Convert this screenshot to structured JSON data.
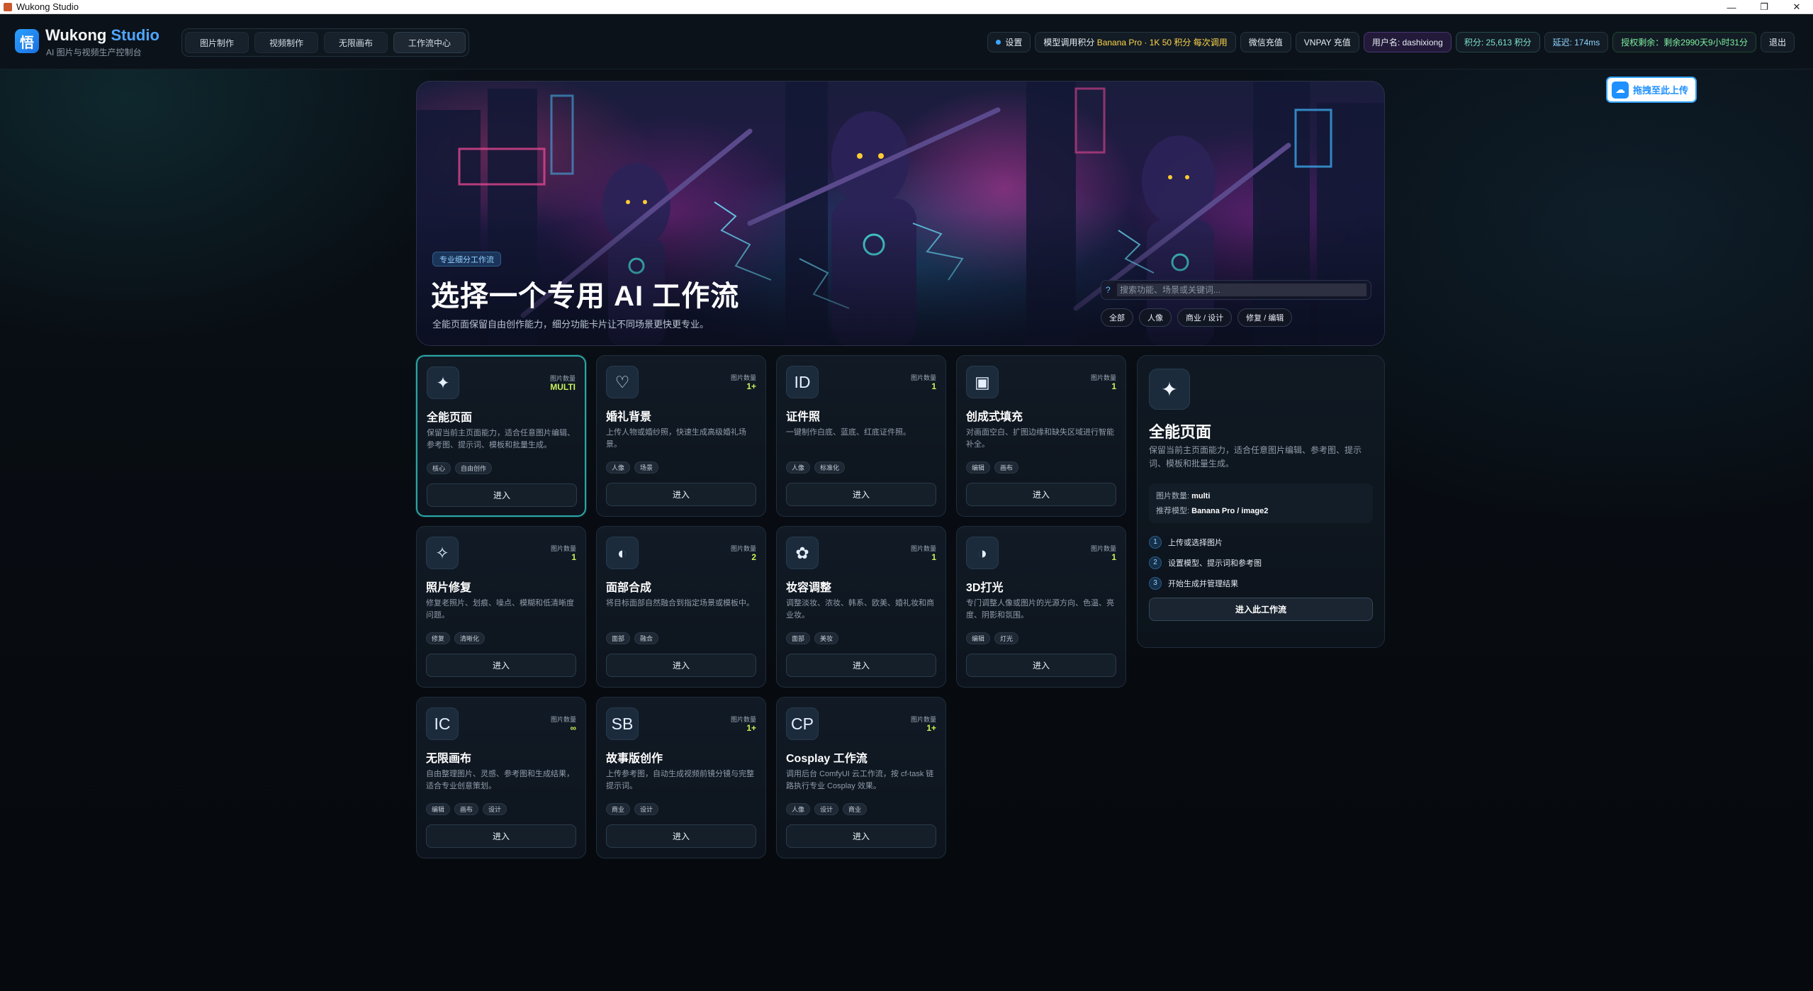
{
  "window": {
    "title": "Wukong Studio",
    "minimize": "—",
    "maximize": "❐",
    "close": "✕"
  },
  "header": {
    "logo_char": "悟",
    "brand_main": "Wukong",
    "brand_accent": "Studio",
    "brand_sub": "AI 图片与视频生产控制台",
    "nav": [
      "图片制作",
      "视频制作",
      "无限画布",
      "工作流中心"
    ],
    "active_nav": "工作流中心",
    "pills": {
      "settings": "设置",
      "model_label": "模型调用积分",
      "model_value": "Banana Pro · 1K  50 积分 每次调用",
      "wechat": "微信充值",
      "vnpay": "VNPAY 充值",
      "user": "用户名: dashixiong",
      "points": "积分: 25,613 积分",
      "latency": "延迟: 174ms",
      "license": "授权剩余：剩余2990天9小时31分",
      "logout": "退出"
    }
  },
  "upload": {
    "label": "拖拽至此上传",
    "icon": "cloud-upload-icon"
  },
  "hero": {
    "badge": "专业细分工作流",
    "title": "选择一个专用 AI 工作流",
    "subtitle": "全能页面保留自由创作能力，细分功能卡片让不同场景更快更专业。",
    "search_placeholder": "搜索功能、场景或关键词...",
    "filters": [
      "全部",
      "人像",
      "商业 / 设计",
      "修复 / 编辑"
    ]
  },
  "count_label": "图片数量",
  "enter_label": "进入",
  "cards": [
    {
      "icon": "✦",
      "icon_name": "sparkle-icon",
      "title": "全能页面",
      "count": "MULTI",
      "desc": "保留当前主页面能力，适合任意图片编辑、参考图、提示词、模板和批量生成。",
      "tags": [
        "核心",
        "自由创作"
      ]
    },
    {
      "icon": "♡",
      "icon_name": "heart-icon",
      "title": "婚礼背景",
      "count": "1+",
      "desc": "上传人物或婚纱照，快速生成高级婚礼场景。",
      "tags": [
        "人像",
        "场景"
      ]
    },
    {
      "icon": "ID",
      "icon_name": "id-icon",
      "title": "证件照",
      "count": "1",
      "desc": "一键制作白底、蓝底、红底证件照。",
      "tags": [
        "人像",
        "标准化"
      ]
    },
    {
      "icon": "▣",
      "icon_name": "fill-icon",
      "title": "创成式填充",
      "count": "1",
      "desc": "对画面空白、扩图边缘和缺失区域进行智能补全。",
      "tags": [
        "编辑",
        "画布"
      ]
    },
    {
      "icon": "✧",
      "icon_name": "restore-icon",
      "title": "照片修复",
      "count": "1",
      "desc": "修复老照片、划痕、噪点、模糊和低清晰度问题。",
      "tags": [
        "修复",
        "清晰化"
      ]
    },
    {
      "icon": "◐",
      "icon_name": "face-icon",
      "title": "面部合成",
      "count": "2",
      "desc": "将目标面部自然融合到指定场景或模板中。",
      "tags": [
        "面部",
        "融合"
      ]
    },
    {
      "icon": "✿",
      "icon_name": "makeup-icon",
      "title": "妆容调整",
      "count": "1",
      "desc": "调整淡妆、浓妆、韩系、欧美、婚礼妆和商业妆。",
      "tags": [
        "面部",
        "美妆"
      ]
    },
    {
      "icon": "◑",
      "icon_name": "light-icon",
      "title": "3D打光",
      "count": "1",
      "desc": "专门调整人像或图片的光源方向、色温、亮度、阴影和氛围。",
      "tags": [
        "编辑",
        "灯光"
      ]
    },
    {
      "icon": "IC",
      "icon_name": "canvas-icon",
      "title": "无限画布",
      "count": "∞",
      "desc": "自由整理图片、灵感、参考图和生成结果，适合专业创意策划。",
      "tags": [
        "编辑",
        "画布",
        "设计"
      ]
    },
    {
      "icon": "SB",
      "icon_name": "storyboard-icon",
      "title": "故事版创作",
      "count": "1+",
      "desc": "上传参考图，自动生成视频前镜分镜与完整提示词。",
      "tags": [
        "商业",
        "设计"
      ]
    },
    {
      "icon": "CP",
      "icon_name": "cosplay-icon",
      "title": "Cosplay 工作流",
      "count": "1+",
      "desc": "调用后台 ComfyUI 云工作流，按 cf-task 链路执行专业 Cosplay 效果。",
      "tags": [
        "人像",
        "设计",
        "商业"
      ]
    }
  ],
  "detail": {
    "icon": "✦",
    "title": "全能页面",
    "desc": "保留当前主页面能力，适合任意图片编辑、参考图、提示词、模板和批量生成。",
    "count_label": "图片数量:",
    "count_value": "multi",
    "model_label": "推荐模型:",
    "model_value": "Banana Pro / image2",
    "steps": [
      "上传或选择图片",
      "设置模型、提示词和参考图",
      "开始生成并管理结果"
    ],
    "button": "进入此工作流"
  },
  "colors": {
    "accent": "#2aa6a6",
    "count": "#c9f25a",
    "brand_accent": "#4fa6ff"
  }
}
